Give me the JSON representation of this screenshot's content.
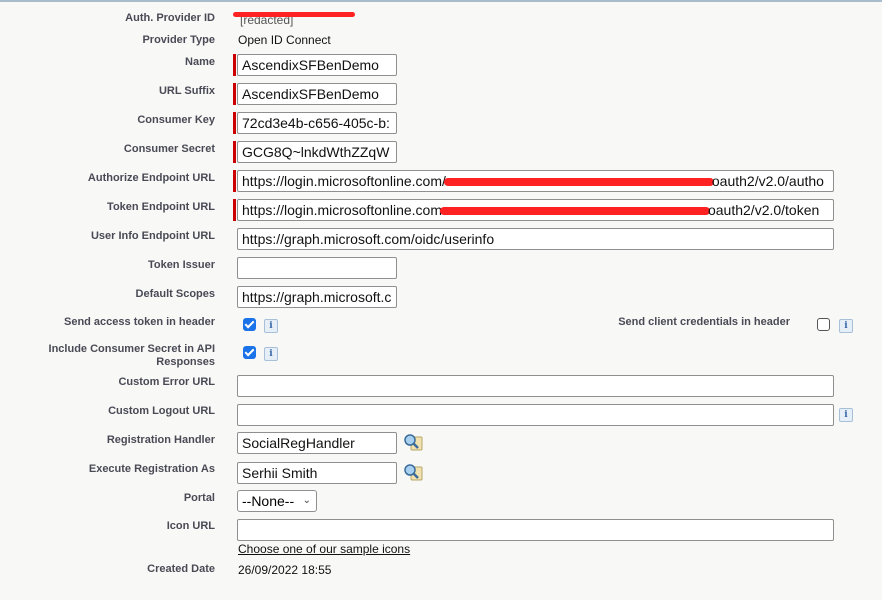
{
  "fields": {
    "auth_provider_id": {
      "label": "Auth. Provider ID",
      "value": "[redacted]"
    },
    "provider_type": {
      "label": "Provider Type",
      "value": "Open ID Connect"
    },
    "name": {
      "label": "Name",
      "value": "AscendixSFBenDemo"
    },
    "url_suffix": {
      "label": "URL Suffix",
      "value": "AscendixSFBenDemo"
    },
    "consumer_key": {
      "label": "Consumer Key",
      "value": "72cd3e4b-c656-405c-b:"
    },
    "consumer_secret": {
      "label": "Consumer Secret",
      "value": "GCG8Q~lnkdWthZZqW"
    },
    "authorize_url": {
      "label": "Authorize Endpoint URL",
      "prefix": "https://login.microsoftonline.com/",
      "suffix": "oauth2/v2.0/autho"
    },
    "token_url": {
      "label": "Token Endpoint URL",
      "prefix": "https://login.microsoftonline.com",
      "suffix": "oauth2/v2.0/token"
    },
    "userinfo_url": {
      "label": "User Info Endpoint URL",
      "value": "https://graph.microsoft.com/oidc/userinfo"
    },
    "token_issuer": {
      "label": "Token Issuer",
      "value": ""
    },
    "default_scopes": {
      "label": "Default Scopes",
      "value": "https://graph.microsoft.c"
    },
    "send_access_token": {
      "label": "Send access token in header",
      "checked": true
    },
    "send_client_credentials": {
      "label": "Send client credentials in header",
      "checked": false
    },
    "include_consumer_secret": {
      "label": "Include Consumer Secret in API Responses",
      "checked": true
    },
    "custom_error_url": {
      "label": "Custom Error URL",
      "value": ""
    },
    "custom_logout_url": {
      "label": "Custom Logout URL",
      "value": ""
    },
    "registration_handler": {
      "label": "Registration Handler",
      "value": "SocialRegHandler"
    },
    "execute_as": {
      "label": "Execute Registration As",
      "value": "Serhii Smith"
    },
    "portal": {
      "label": "Portal",
      "value": "--None--"
    },
    "icon_url": {
      "label": "Icon URL",
      "value": "",
      "link": "Choose one of our sample icons"
    },
    "created_date": {
      "label": "Created Date",
      "value": "26/09/2022 18:55"
    }
  },
  "info_glyph": "i",
  "colors": {
    "required": "#cc0000",
    "checkbox": "#1a73e8",
    "redaction": "#ff2222"
  }
}
